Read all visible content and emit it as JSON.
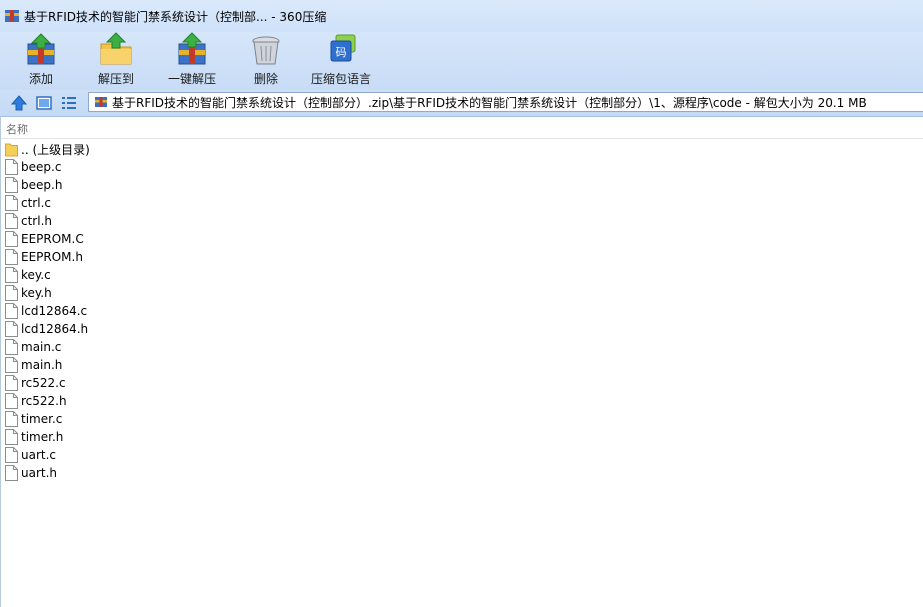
{
  "window": {
    "title": "基于RFID技术的智能门禁系统设计（控制部... - 360压缩"
  },
  "toolbar": {
    "add_label": "添加",
    "extract_to_label": "解压到",
    "one_click_extract_label": "一键解压",
    "delete_label": "删除",
    "compress_info_label": "压缩包语言"
  },
  "address": {
    "path": "基于RFID技术的智能门禁系统设计（控制部分）.zip\\基于RFID技术的智能门禁系统设计（控制部分）\\1、源程序\\code - 解包大小为 20.1 MB"
  },
  "columns": {
    "name": "名称"
  },
  "files": [
    {
      "name": ".. (上级目录)",
      "type": "folder"
    },
    {
      "name": "beep.c",
      "type": "file"
    },
    {
      "name": "beep.h",
      "type": "file"
    },
    {
      "name": "ctrl.c",
      "type": "file"
    },
    {
      "name": "ctrl.h",
      "type": "file"
    },
    {
      "name": "EEPROM.C",
      "type": "file"
    },
    {
      "name": "EEPROM.h",
      "type": "file"
    },
    {
      "name": "key.c",
      "type": "file"
    },
    {
      "name": "key.h",
      "type": "file"
    },
    {
      "name": "lcd12864.c",
      "type": "file"
    },
    {
      "name": "lcd12864.h",
      "type": "file"
    },
    {
      "name": "main.c",
      "type": "file"
    },
    {
      "name": "main.h",
      "type": "file"
    },
    {
      "name": "rc522.c",
      "type": "file"
    },
    {
      "name": "rc522.h",
      "type": "file"
    },
    {
      "name": "timer.c",
      "type": "file"
    },
    {
      "name": "timer.h",
      "type": "file"
    },
    {
      "name": "uart.c",
      "type": "file"
    },
    {
      "name": "uart.h",
      "type": "file"
    }
  ],
  "colors": {
    "titlebar": "#d6e6fa",
    "accent": "#1e6fd1"
  }
}
